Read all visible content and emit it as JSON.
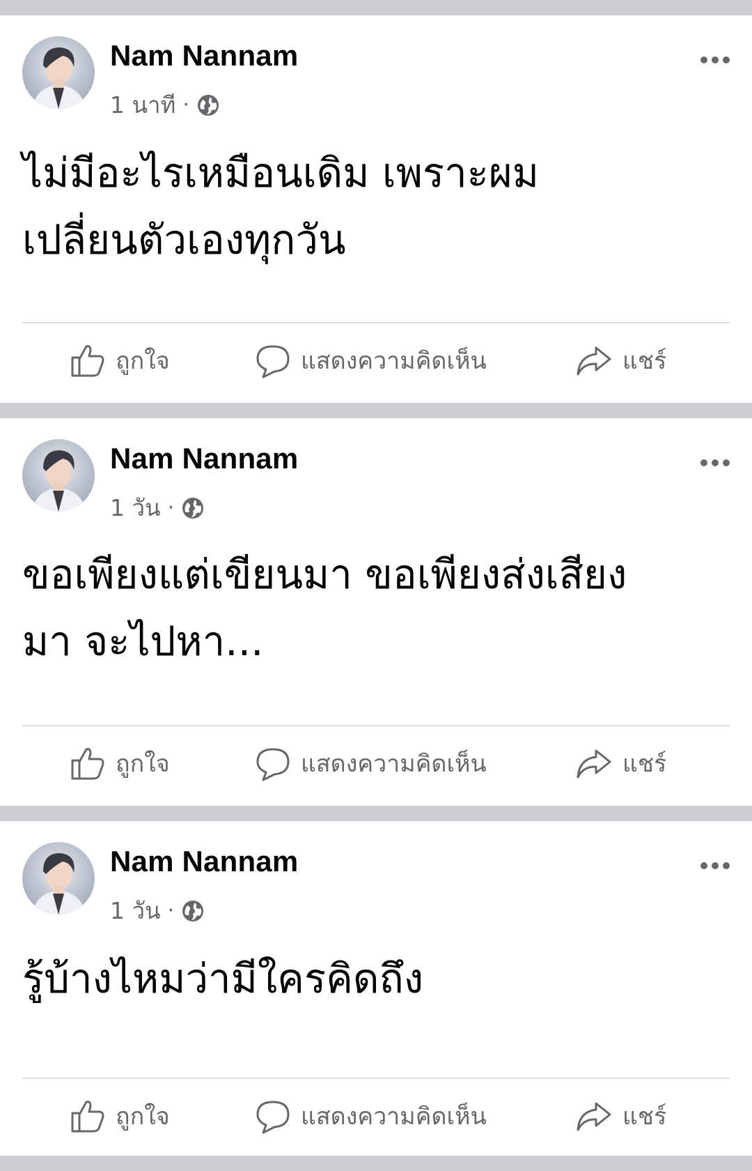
{
  "posts": [
    {
      "author": "Nam Nannam",
      "time": "1 นาที",
      "separator": "·",
      "privacy_icon": "globe-icon",
      "text": "ไม่มีอะไรเหมือนเดิม เพราะผม\nเปลี่ยนตัวเองทุกวัน",
      "actions": {
        "like": "ถูกใจ",
        "comment": "แสดงความคิดเห็น",
        "share": "แชร์"
      }
    },
    {
      "author": "Nam Nannam",
      "time": "1 วัน",
      "separator": "·",
      "privacy_icon": "globe-icon",
      "text": "ขอเพียงแต่เขียนมา ขอเพียงส่งเสียง\nมา จะไปหา...",
      "actions": {
        "like": "ถูกใจ",
        "comment": "แสดงความคิดเห็น",
        "share": "แชร์"
      }
    },
    {
      "author": "Nam Nannam",
      "time": "1 วัน",
      "separator": "·",
      "privacy_icon": "globe-icon",
      "text": "รู้บ้างไหมว่ามีใครคิดถึง",
      "actions": {
        "like": "ถูกใจ",
        "comment": "แสดงความคิดเห็น",
        "share": "แชร์"
      }
    }
  ],
  "colors": {
    "background": "#ccced3",
    "card": "#ffffff",
    "primary_text": "#050505",
    "secondary_text": "#65676b",
    "divider": "#dadde1"
  }
}
